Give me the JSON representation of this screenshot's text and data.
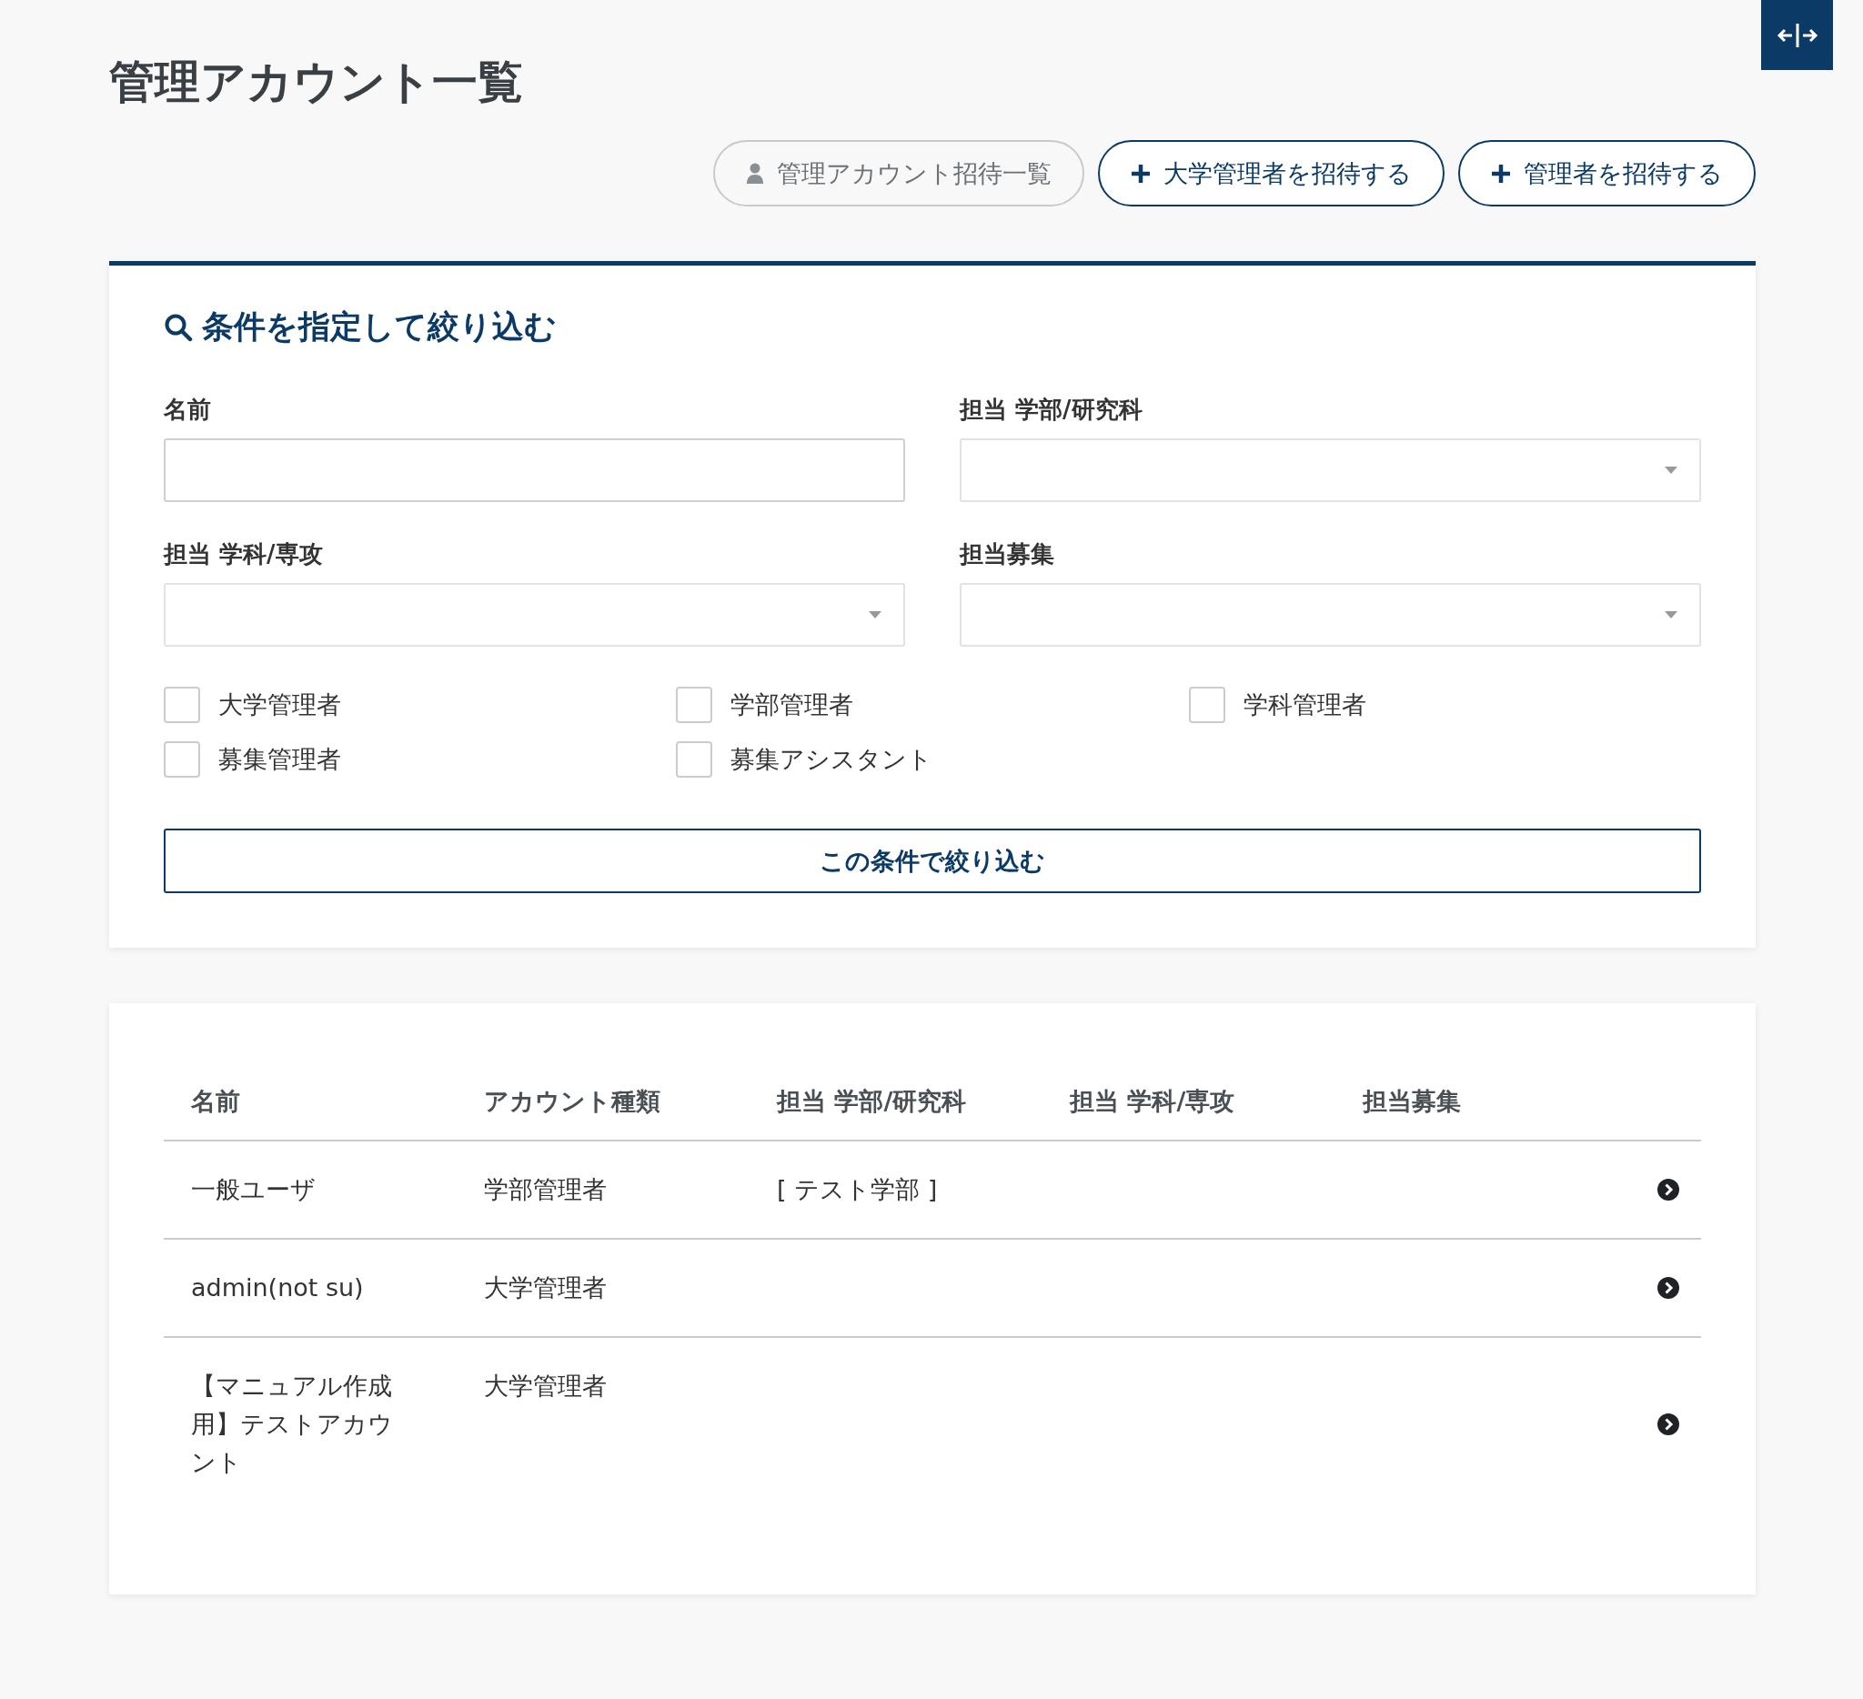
{
  "title": "管理アカウント一覧",
  "toolbar": {
    "buttons": [
      {
        "label": "管理アカウント招待一覧",
        "kind": "secondary"
      },
      {
        "label": "大学管理者を招待する",
        "kind": "add"
      },
      {
        "label": "管理者を招待する",
        "kind": "add"
      }
    ]
  },
  "filter": {
    "heading": "条件を指定して絞り込む",
    "fields": [
      {
        "label": "名前",
        "kind": "text"
      },
      {
        "label": "担当 学部/研究科",
        "kind": "select"
      },
      {
        "label": "担当 学科/専攻",
        "kind": "select"
      },
      {
        "label": "担当募集",
        "kind": "select"
      }
    ],
    "checkboxes": [
      {
        "label": "大学管理者",
        "checked": false
      },
      {
        "label": "学部管理者",
        "checked": false
      },
      {
        "label": "学科管理者",
        "checked": false
      },
      {
        "label": "募集管理者",
        "checked": false
      },
      {
        "label": "募集アシスタント",
        "checked": false
      }
    ],
    "submit": "この条件で絞り込む"
  },
  "table": {
    "columns": [
      "名前",
      "アカウント種類",
      "担当 学部/研究科",
      "担当 学科/専攻",
      "担当募集"
    ],
    "rows": [
      {
        "name": "一般ユーザ",
        "account_type": "学部管理者",
        "faculty": "[ テスト学部 ]"
      },
      {
        "name": "admin(not su)",
        "account_type": "大学管理者"
      },
      {
        "name": "【マニュアル作成用】テストアカウント",
        "account_type": "大学管理者"
      }
    ]
  }
}
